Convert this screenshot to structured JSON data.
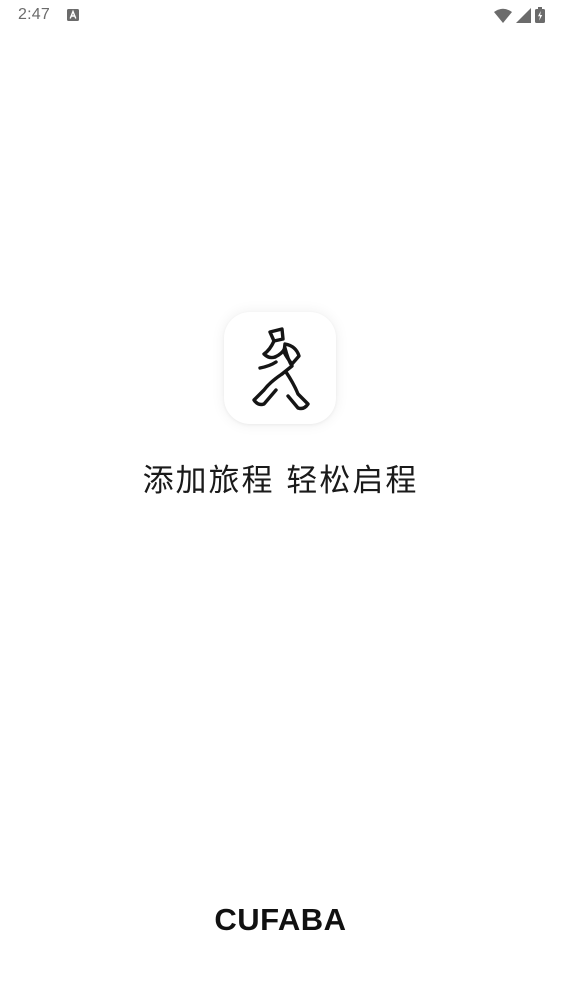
{
  "status_bar": {
    "time": "2:47",
    "notification_icon": "a-letter-icon",
    "wifi_icon": "wifi-icon",
    "signal_icon": "cell-signal-icon",
    "battery_icon": "battery-charging-icon"
  },
  "splash": {
    "app_icon": "walking-person-backpack-icon",
    "slogan": "添加旅程 轻松启程",
    "brand": "CUFABA"
  },
  "colors": {
    "background": "#ffffff",
    "text": "#1a1a1a",
    "status_text": "#6b6b6b"
  }
}
